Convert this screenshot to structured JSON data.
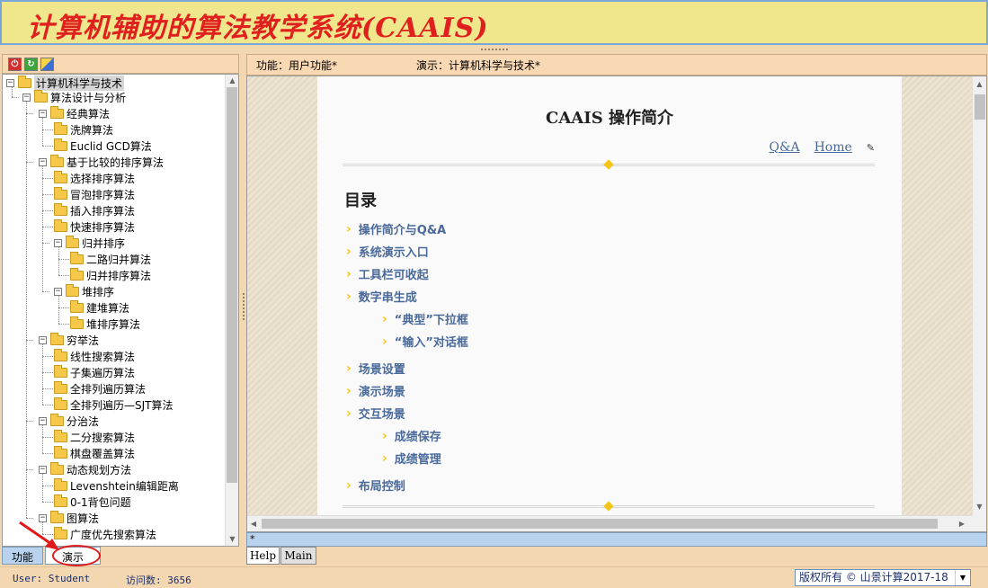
{
  "app": {
    "title": "计算机辅助的算法教学系统(CAAIS)"
  },
  "tree": {
    "root": "计算机科学与技术",
    "nodes": [
      "算法设计与分析",
      "经典算法",
      "洗牌算法",
      "Euclid GCD算法",
      "基于比较的排序算法",
      "选择排序算法",
      "冒泡排序算法",
      "插入排序算法",
      "快速排序算法",
      "归并排序",
      "二路归并算法",
      "归并排序算法",
      "堆排序",
      "建堆算法",
      "堆排序算法",
      "穷举法",
      "线性搜索算法",
      "子集遍历算法",
      "全排列遍历算法",
      "全排列遍历—SJT算法",
      "分治法",
      "二分搜索算法",
      "棋盘覆盖算法",
      "动态规划方法",
      "Levenshtein编辑距离",
      "0-1背包问题",
      "图算法",
      "广度优先搜索算法"
    ]
  },
  "left_tabs": {
    "func": "功能",
    "demo": "演示"
  },
  "right_header": {
    "func": "功能：用户功能*",
    "demo": "演示：计算机科学与技术*"
  },
  "doc": {
    "title": "CAAIS 操作简介",
    "link_qa": "Q&A",
    "link_home": "Home",
    "toc_head": "目录",
    "toc": [
      "操作简介与Q&A",
      "系统演示入口",
      "工具栏可收起",
      "数字串生成",
      "“典型”下拉框",
      "“输入”对话框",
      "场景设置",
      "演示场景",
      "交互场景",
      "成绩保存",
      "成绩管理",
      "布局控制"
    ]
  },
  "status_strip": "*",
  "bottom_tabs": {
    "help": "Help",
    "main": "Main"
  },
  "footer": {
    "user": "User: Student",
    "visits": "访问数: 3656",
    "copyright": "版权所有 © 山景计算2017-18"
  },
  "colors": {
    "title": "#e0201e",
    "title_bar": "#f0e68c",
    "panel": "#f3d7b0",
    "link": "#4a6a9a",
    "bullet": "#f5c518"
  },
  "icons": [
    "power-icon",
    "refresh-icon",
    "tool-icon",
    "folder-icon",
    "pin-icon",
    "chevron-right-icon",
    "dropdown-arrow-icon"
  ]
}
